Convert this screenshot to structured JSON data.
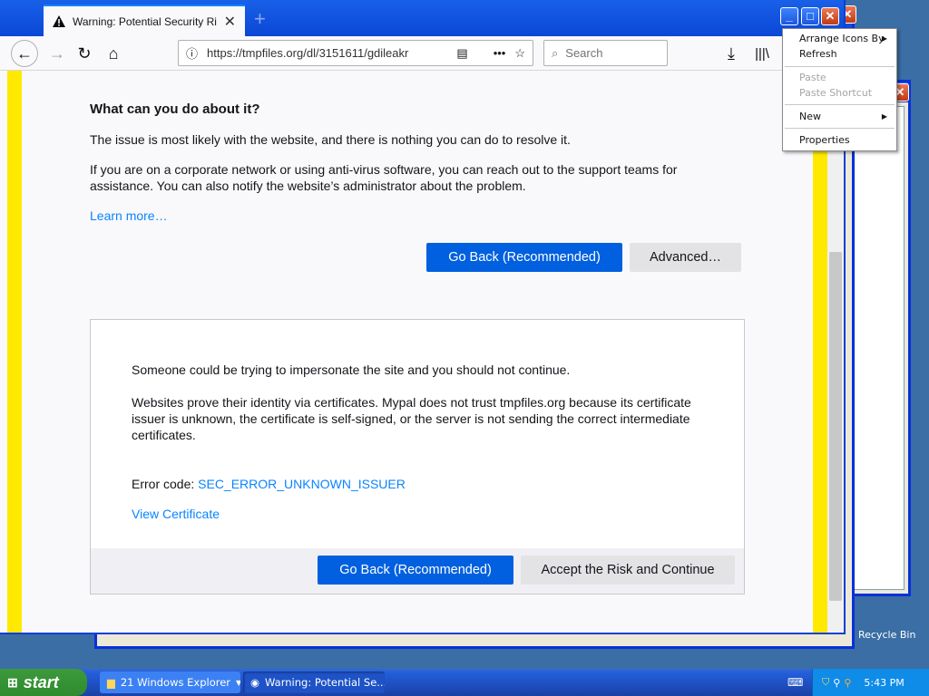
{
  "browser": {
    "tab_title": "Warning: Potential Security Risk Ahead",
    "url": "https://tmpfiles.org/dl/3151611/gdileakr",
    "search_placeholder": "Search"
  },
  "page": {
    "heading": "What can you do about it?",
    "para1": "The issue is most likely with the website, and there is nothing you can do to resolve it.",
    "para2": "If you are on a corporate network or using anti-virus software, you can reach out to the support teams for assistance. You can also notify the website’s administrator about the problem.",
    "learn_more": "Learn more…",
    "go_back_label": "Go Back (Recommended)",
    "advanced_label": "Advanced…"
  },
  "advanced": {
    "line1": "Someone could be trying to impersonate the site and you should not continue.",
    "line2": "Websites prove their identity via certificates. Mypal does not trust tmpfiles.org because its certificate issuer is unknown, the certificate is self-signed, or the server is not sending the correct intermediate certificates.",
    "error_label": "Error code:",
    "error_code": "SEC_ERROR_UNKNOWN_ISSUER",
    "view_certificate": "View Certificate",
    "go_back_label": "Go Back (Recommended)",
    "accept_label": "Accept the Risk and Continue"
  },
  "context_menu": {
    "arrange_icons": "Arrange Icons By",
    "refresh": "Refresh",
    "paste": "Paste",
    "paste_shortcut": "Paste Shortcut",
    "new": "New",
    "properties": "Properties"
  },
  "taskbar": {
    "start": "start",
    "explorer": "21 Windows Explorer",
    "browser": "Warning: Potential Se...",
    "clock": "5:43 PM"
  },
  "desktop": {
    "recycle_bin": "Recycle Bin"
  },
  "colors": {
    "accent": "#0060df",
    "link": "#0a84ff",
    "warning_stripe": "#ffe900",
    "xp_blue": "#0a3fd8"
  }
}
